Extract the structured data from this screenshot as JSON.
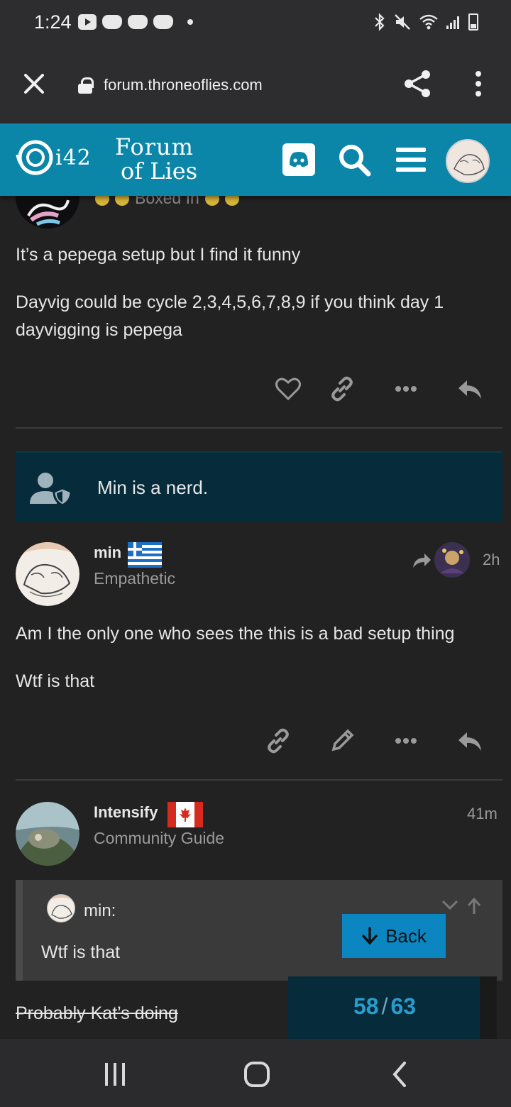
{
  "status_bar": {
    "time": "1:24",
    "left_icons": [
      "youtube-icon",
      "game-controller-icon",
      "game-controller-icon",
      "game-controller-icon",
      "notification-dot"
    ],
    "right_icons": [
      "bluetooth-icon",
      "mute-icon",
      "wifi-icon",
      "signal-icon",
      "battery-icon"
    ]
  },
  "browser": {
    "url": "forum.throneoflies.com"
  },
  "forum_header": {
    "logo_number": "i42",
    "logo_line1": "Forum",
    "logo_line2": "of Lies",
    "brand_color": "#0b86a8"
  },
  "posts": [
    {
      "user_title": "Boxed In",
      "paragraphs": [
        "It’s a pepega setup but I find it funny",
        "Dayvig could be cycle 2,3,4,5,6,7,8,9 if you think day 1",
        "dayvigging is pepega"
      ]
    },
    {
      "username": "min",
      "user_title": "Empathetic",
      "time": "2h",
      "paragraphs": [
        "Am I the only one who sees the this is a bad setup thing",
        "Wtf is that"
      ]
    },
    {
      "username": "Intensify",
      "user_title": "Community Guide",
      "time": "41m",
      "quote": {
        "author": "min:",
        "text": "Wtf is that"
      },
      "struck_text": "Probably Kat’s doing"
    }
  ],
  "notice": {
    "text": "Min is a nerd."
  },
  "back_button": {
    "label": "Back"
  },
  "progress": {
    "current": "58",
    "total": "63"
  },
  "colors": {
    "accent": "#0b86a8",
    "notice_bg": "#062b3a",
    "page_bg": "#222222"
  }
}
